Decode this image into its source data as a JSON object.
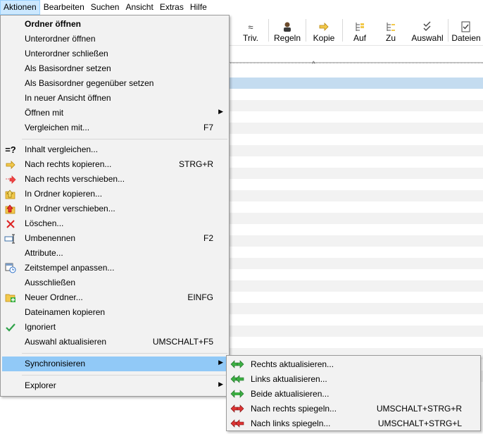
{
  "menubar": {
    "items": [
      {
        "label": "Aktionen"
      },
      {
        "label": "Bearbeiten"
      },
      {
        "label": "Suchen"
      },
      {
        "label": "Ansicht"
      },
      {
        "label": "Extras"
      },
      {
        "label": "Hilfe"
      }
    ]
  },
  "toolbar": {
    "buttons": [
      {
        "label": "Triv.",
        "icon": "approx-icon"
      },
      {
        "label": "Regeln",
        "icon": "person-icon"
      },
      {
        "label": "Kopie",
        "icon": "arrow-right-icon"
      },
      {
        "label": "Auf",
        "icon": "tree-up-icon"
      },
      {
        "label": "Zu",
        "icon": "tree-down-icon"
      },
      {
        "label": "Auswahl",
        "icon": "double-check-icon"
      },
      {
        "label": "Dateien",
        "icon": "file-check-icon"
      }
    ]
  },
  "menu": {
    "items": [
      {
        "label": "Ordner öffnen",
        "bold": true
      },
      {
        "label": "Unterordner öffnen"
      },
      {
        "label": "Unterordner schließen"
      },
      {
        "label": "Als Basisordner setzen"
      },
      {
        "label": "Als Basisordner gegenüber setzen"
      },
      {
        "label": "In neuer Ansicht öffnen"
      },
      {
        "label": "Öffnen mit",
        "submenu": true
      },
      {
        "label": "Vergleichen mit...",
        "shortcut": "F7"
      },
      {
        "label": "Inhalt vergleichen...",
        "icon": "compare-icon"
      },
      {
        "label": "Nach rechts kopieren...",
        "shortcut": "STRG+R",
        "icon": "copy-right-icon"
      },
      {
        "label": "Nach rechts verschieben...",
        "icon": "move-right-icon"
      },
      {
        "label": "In Ordner kopieren...",
        "icon": "copy-to-folder-icon"
      },
      {
        "label": "In Ordner verschieben...",
        "icon": "move-to-folder-icon"
      },
      {
        "label": "Löschen...",
        "icon": "delete-icon"
      },
      {
        "label": "Umbenennen",
        "shortcut": "F2",
        "icon": "rename-icon"
      },
      {
        "label": "Attribute..."
      },
      {
        "label": "Zeitstempel anpassen...",
        "icon": "timestamp-icon"
      },
      {
        "label": "Ausschließen"
      },
      {
        "label": "Neuer Ordner...",
        "shortcut": "EINFG",
        "icon": "new-folder-icon"
      },
      {
        "label": "Dateinamen kopieren"
      },
      {
        "label": "Ignoriert",
        "icon": "checkmark-icon"
      },
      {
        "label": "Auswahl aktualisieren",
        "shortcut": "UMSCHALT+F5"
      },
      {
        "label": "Synchronisieren",
        "submenu": true
      },
      {
        "label": "Explorer",
        "submenu": true
      }
    ]
  },
  "submenu": {
    "items": [
      {
        "label": "Rechts aktualisieren...",
        "icon": "sync-right-green-icon"
      },
      {
        "label": "Links aktualisieren...",
        "icon": "sync-left-green-icon"
      },
      {
        "label": "Beide aktualisieren...",
        "icon": "sync-both-green-icon"
      },
      {
        "label": "Nach rechts spiegeln...",
        "shortcut": "UMSCHALT+STRG+R",
        "icon": "mirror-right-red-icon"
      },
      {
        "label": "Nach links spiegeln...",
        "shortcut": "UMSCHALT+STRG+L",
        "icon": "mirror-left-red-icon"
      }
    ]
  },
  "colors": {
    "highlight": "#91c9f7",
    "menu_bg": "#f2f2f2",
    "selected_row": "#c4dcf0",
    "active_menubar": "#cce8ff"
  }
}
